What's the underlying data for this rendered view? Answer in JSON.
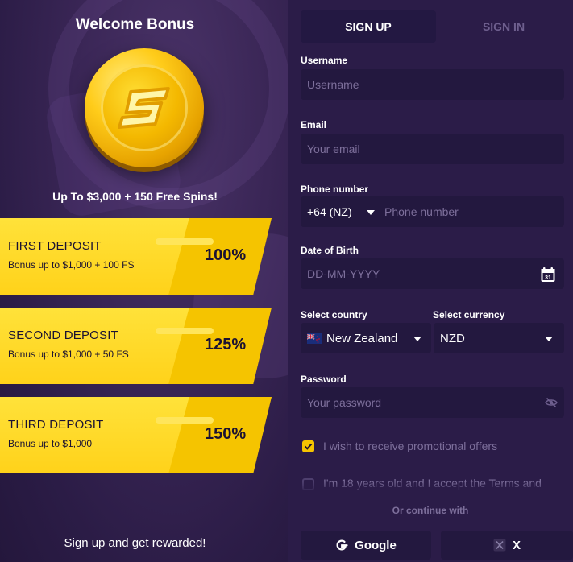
{
  "promo": {
    "title": "Welcome Bonus",
    "offer": "Up To $3,000 + 150 Free Spins!",
    "deposits": [
      {
        "title": "FIRST DEPOSIT",
        "subtitle": "Bonus up to $1,000 + 100 FS",
        "percent": "100%"
      },
      {
        "title": "SECOND DEPOSIT",
        "subtitle": "Bonus up to $1,000 + 50 FS",
        "percent": "125%"
      },
      {
        "title": "THIRD DEPOSIT",
        "subtitle": "Bonus up to $1,000",
        "percent": "150%"
      }
    ],
    "footer": "Sign up and get rewarded!"
  },
  "tabs": {
    "signup": "SIGN UP",
    "signin": "SIGN IN"
  },
  "form": {
    "username": {
      "label": "Username",
      "placeholder": "Username"
    },
    "email": {
      "label": "Email",
      "placeholder": "Your email"
    },
    "phone": {
      "label": "Phone number",
      "code": "+64 (NZ)",
      "placeholder": "Phone number"
    },
    "dob": {
      "label": "Date of Birth",
      "placeholder": "DD-MM-YYYY",
      "calendar_day": "31"
    },
    "country": {
      "label": "Select country",
      "value": "New Zealand"
    },
    "currency": {
      "label": "Select currency",
      "value": "NZD"
    },
    "password": {
      "label": "Password",
      "placeholder": "Your password"
    },
    "promo_opt_in": {
      "label": "I wish to receive promotional offers",
      "checked": true
    },
    "terms": {
      "label": "I'm 18 years old and I accept the Terms and",
      "checked": false
    }
  },
  "social": {
    "divider": "Or continue with",
    "google": "Google",
    "x": "X"
  },
  "colors": {
    "accent": "#ffd21a",
    "bg": "#2b1c48",
    "input": "#23183f"
  }
}
